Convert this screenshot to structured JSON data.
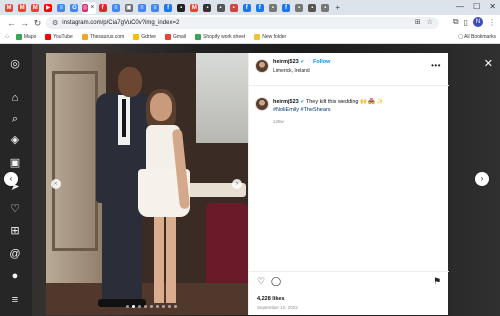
{
  "browser": {
    "tabs": [
      {
        "icon": "gmail-icon",
        "color": "#ea4335",
        "glyph": "M"
      },
      {
        "icon": "gmail-icon",
        "color": "#ea4335",
        "glyph": "M"
      },
      {
        "icon": "gmail-icon",
        "color": "#ea4335",
        "glyph": "M"
      },
      {
        "icon": "youtube-icon",
        "color": "#ff0000",
        "glyph": "▶"
      },
      {
        "icon": "docs-icon",
        "color": "#4285f4",
        "glyph": "≡"
      },
      {
        "icon": "google-icon",
        "color": "#4285f4",
        "glyph": "G"
      },
      {
        "icon": "instagram-icon",
        "color": "#d62976",
        "glyph": "◎",
        "active": true
      },
      {
        "icon": "flipboard-icon",
        "color": "#e12828",
        "glyph": "f"
      },
      {
        "icon": "docs-icon",
        "color": "#4285f4",
        "glyph": "≡"
      },
      {
        "icon": "tab-icon",
        "color": "#6b6b6b",
        "glyph": "▣"
      },
      {
        "icon": "docs-icon",
        "color": "#4285f4",
        "glyph": "≡"
      },
      {
        "icon": "docs-icon",
        "color": "#4285f4",
        "glyph": "≡"
      },
      {
        "icon": "facebook-icon",
        "color": "#1877f2",
        "glyph": "f"
      },
      {
        "icon": "tab-icon",
        "color": "#222222",
        "glyph": "▪"
      },
      {
        "icon": "gmail-icon",
        "color": "#ea4335",
        "glyph": "M"
      },
      {
        "icon": "tab-icon",
        "color": "#333333",
        "glyph": "▪"
      },
      {
        "icon": "tab-icon",
        "color": "#555555",
        "glyph": "▪"
      },
      {
        "icon": "tab-icon",
        "color": "#c44",
        "glyph": "▪"
      },
      {
        "icon": "facebook-icon",
        "color": "#1877f2",
        "glyph": "f"
      },
      {
        "icon": "facebook-icon",
        "color": "#1877f2",
        "glyph": "f"
      },
      {
        "icon": "tab-icon",
        "color": "#777",
        "glyph": "▪"
      },
      {
        "icon": "tab-icon",
        "color": "#1877f2",
        "glyph": "f"
      },
      {
        "icon": "tab-icon",
        "color": "#777",
        "glyph": "▪"
      },
      {
        "icon": "tab-icon",
        "color": "#555",
        "glyph": "▪"
      },
      {
        "icon": "tab-icon",
        "color": "#777",
        "glyph": "▪"
      }
    ],
    "url": "instagram.com/p/Cia7gVuC0v?img_index=2",
    "profile_initial": "N",
    "bookmarks": [
      {
        "label": "Maps",
        "color": "#34a853"
      },
      {
        "label": "YouTube",
        "color": "#ff0000"
      },
      {
        "label": "Thesaurus.com",
        "color": "#f5a623"
      },
      {
        "label": "Gdrive",
        "color": "#fbbc04"
      },
      {
        "label": "Gmail",
        "color": "#ea4335"
      },
      {
        "label": "Shopify work sheet",
        "color": "#34a853"
      },
      {
        "label": "New folder",
        "color": "#f1c232"
      }
    ],
    "all_bookmarks": "All Bookmarks"
  },
  "post": {
    "username": "heirmj523",
    "follow_label": "Follow",
    "location": "Limerick, Ireland",
    "caption_text": "They kilt this wedding 🙌 💑 ✨",
    "caption_tags": "#NoliEmily #TheShears",
    "caption_time": "128w",
    "likes": "4,228 likes",
    "date": "September 12, 2022"
  },
  "colors": {
    "accent": "#0095f6",
    "modal_bg": "#ffffff"
  }
}
